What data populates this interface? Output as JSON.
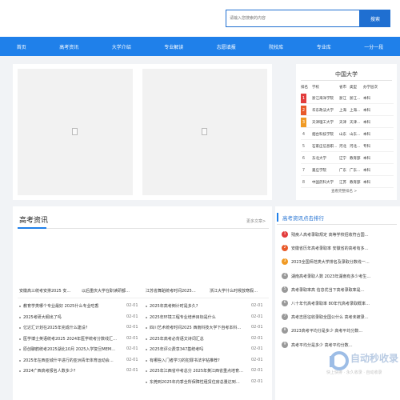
{
  "search": {
    "placeholder": "请输入您搜索的内容",
    "button": "搜索"
  },
  "nav": [
    "首页",
    "高考资讯",
    "大学介绍",
    "专业解读",
    "志愿填报",
    "院校库",
    "专业库",
    "一分一段"
  ],
  "ranking": {
    "title": "中国大学",
    "headers": [
      "排名",
      "学校",
      "省市",
      "类型",
      "办学层次"
    ],
    "rows": [
      {
        "rank": "1",
        "school": "浙江海洋学院",
        "city": "浙江",
        "kind": "浙江…",
        "level": "本科"
      },
      {
        "rank": "2",
        "school": "华东政法大学",
        "city": "上海",
        "kind": "上海…",
        "level": "本科"
      },
      {
        "rank": "3",
        "school": "天津理工大学",
        "city": "天津",
        "kind": "天津…",
        "level": "本科"
      },
      {
        "rank": "4",
        "school": "烟台科技学院",
        "city": "山东",
        "kind": "山东…",
        "level": "本科"
      },
      {
        "rank": "5",
        "school": "石家庄信息职…",
        "city": "河北",
        "kind": "河北…",
        "level": "专科"
      },
      {
        "rank": "6",
        "school": "东北大学",
        "city": "辽宁",
        "kind": "教育部",
        "level": "本科"
      },
      {
        "rank": "7",
        "school": "嘉应学院",
        "city": "广东",
        "kind": "广东…",
        "level": "本科"
      },
      {
        "rank": "8",
        "school": "中国药科大学",
        "city": "江苏",
        "kind": "教育部",
        "level": "本科"
      }
    ],
    "more": "查看完整排名 >"
  },
  "news": {
    "title": "高考资讯",
    "more": "更多文章>",
    "captions": [
      "安徽高三统考安排2025 安…",
      "以后重庆大学在职读研都…",
      "江苏省舞蹈统考时间2025…",
      "浙江大学什么时候放寒假…"
    ],
    "left_list": [
      {
        "text": "教育学类哪个专业最好 2025什么专业吃香",
        "date": "02-01"
      },
      {
        "text": "2025考研大纲出了吗",
        "date": "02-01"
      },
      {
        "text": "亿达汇计划在2025年完成什么建设?",
        "date": "02-01"
      },
      {
        "text": "医学博士英语统考2025 2024年医学统考分数线汇…",
        "date": "02-01"
      },
      {
        "text": "原创聊鹤统考2025湖北10月 2025入学复旦MEM…",
        "date": "02-01"
      },
      {
        "text": "2025年在西亚城什平进行的亚洲青年体育运动会…",
        "date": "02-01"
      },
      {
        "text": "2024广西高考报名人数多少?",
        "date": "02-01"
      }
    ],
    "right_list": [
      {
        "text": "2025年高考倒计时是多久?",
        "date": "02-01"
      },
      {
        "text": "2025年环境工程专业培养目标是什么",
        "date": "02-01"
      },
      {
        "text": "四川艺术统考时间2025 西南科技大学下自考本科…",
        "date": "02-01"
      },
      {
        "text": "2025年高考必背语文诗词汇总",
        "date": "02-01"
      },
      {
        "text": "2025年评公费享347基统考吗",
        "date": "02-01"
      },
      {
        "text": "有哪些入门者学习的犯罪书法字帖推荐?",
        "date": "02-01"
      },
      {
        "text": "2025年江西省中考总分 2025年黄江西省重点培育…",
        "date": "02-01"
      },
      {
        "text": "东莞到2025年内季全所保障性租赁住房总量达到…",
        "date": "02-01"
      }
    ]
  },
  "hot": {
    "title": "高考资讯点击排行",
    "items": [
      {
        "num": "1",
        "text": "残疾人高考录取规定 高等学校招收符合国…"
      },
      {
        "num": "2",
        "text": "安徽省历年高考录取率 安徽省的高考有多…"
      },
      {
        "num": "3",
        "text": "2023全国师范类大学排名及录取分数线一…"
      },
      {
        "num": "4",
        "text": "湖南高考录取人数 2023年湖南有多少考生…"
      },
      {
        "num": "5",
        "text": "高考录取率高 信息优当下高考录取率是…"
      },
      {
        "num": "6",
        "text": "八十年代高考录取率 80年代高考录取概率…"
      },
      {
        "num": "7",
        "text": "高考志愿征收录取全国公什么 高考未被录…"
      },
      {
        "num": "8",
        "text": "2023高考平均分是多少 高考平均分数…"
      },
      {
        "num": "9",
        "text": "高考平均分是多少 高考平均分数…"
      }
    ]
  },
  "watermark": {
    "title": "自动秒收录",
    "subtitle": "快上快排 · 永久收录 · 自动收录"
  },
  "colors": {
    "primary": "#1f80ea",
    "rank1": "#e23c3c",
    "rank2": "#e85a2a",
    "rank3": "#f09a24",
    "rank_other": "#999999"
  }
}
